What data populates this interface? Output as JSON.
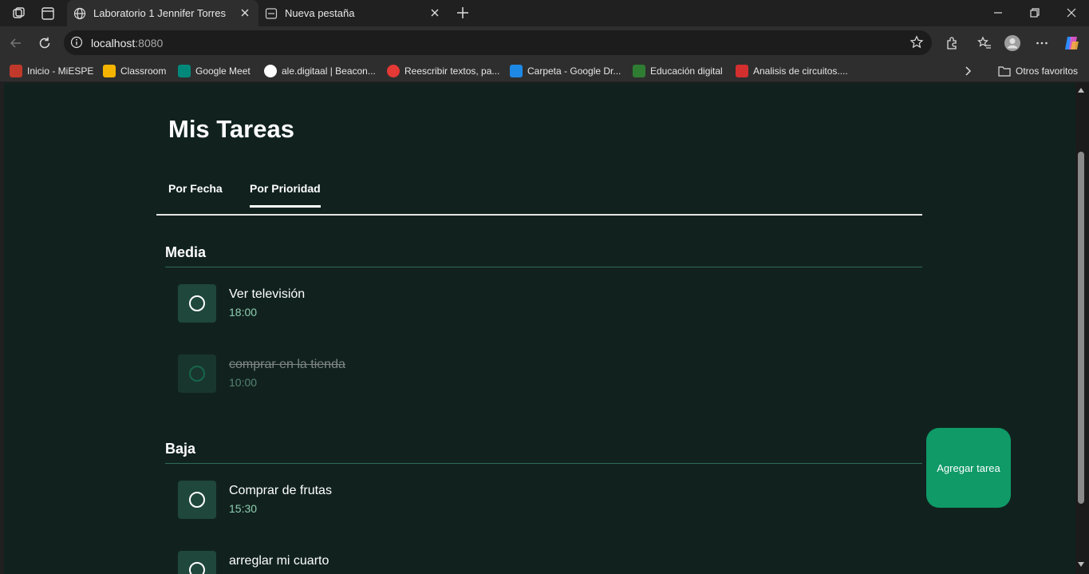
{
  "browser": {
    "tabs": [
      {
        "title": "Laboratorio 1 Jennifer Torres",
        "active": true
      },
      {
        "title": "Nueva pestaña",
        "active": false
      }
    ],
    "url_host": "localhost",
    "url_port": ":8080",
    "bookmarks": [
      {
        "label": "Inicio - MiESPE",
        "icon_color": "#c0392b"
      },
      {
        "label": "Classroom",
        "icon_color": "#f4b400"
      },
      {
        "label": "Google Meet",
        "icon_color": "#00897b"
      },
      {
        "label": "ale.digitaal | Beacon...",
        "icon_color": "#ffffff"
      },
      {
        "label": "Reescribir textos, pa...",
        "icon_color": "#e53935"
      },
      {
        "label": "Carpeta - Google Dr...",
        "icon_color": "#1e88e5"
      },
      {
        "label": "Educación digital",
        "icon_color": "#2e7d32"
      },
      {
        "label": "Analisis de circuitos....",
        "icon_color": "#d32f2f"
      }
    ],
    "other_favorites": "Otros favoritos"
  },
  "app": {
    "title": "Mis Tareas",
    "tabs": [
      {
        "label": "Por Fecha",
        "selected": false
      },
      {
        "label": "Por Prioridad",
        "selected": true
      }
    ],
    "sections": [
      {
        "title": "Media",
        "tasks": [
          {
            "name": "Ver televisión",
            "time": "18:00",
            "done": false
          },
          {
            "name": "comprar en la tienda",
            "time": "10:00",
            "done": true
          }
        ]
      },
      {
        "title": "Baja",
        "tasks": [
          {
            "name": "Comprar de frutas",
            "time": "15:30",
            "done": false
          },
          {
            "name": "arreglar mi cuarto",
            "time": "",
            "done": false
          }
        ]
      }
    ],
    "add_button": "Agregar tarea"
  },
  "colors": {
    "page_bg": "#11221e",
    "accent": "#0f9a68",
    "time_text": "#8fcfb3"
  }
}
